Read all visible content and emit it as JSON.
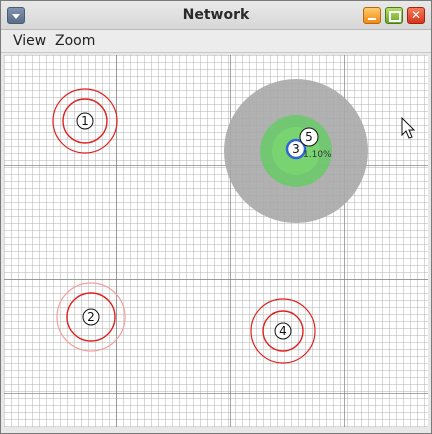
{
  "window": {
    "title": "Network"
  },
  "menu": {
    "items": [
      {
        "label": "View"
      },
      {
        "label": "Zoom"
      }
    ]
  },
  "nodes": [
    {
      "id": "1",
      "label": "1"
    },
    {
      "id": "2",
      "label": "2"
    },
    {
      "id": "3",
      "label": "3"
    },
    {
      "id": "4",
      "label": "4"
    },
    {
      "id": "5",
      "label": "5"
    }
  ],
  "highlight": {
    "percent_text": "1.10%"
  },
  "colors": {
    "ring_red": "#e02020",
    "range_gray": "#a9a9a9",
    "signal_green": "#5fcf5f",
    "selected_blue": "#2f63d6"
  }
}
